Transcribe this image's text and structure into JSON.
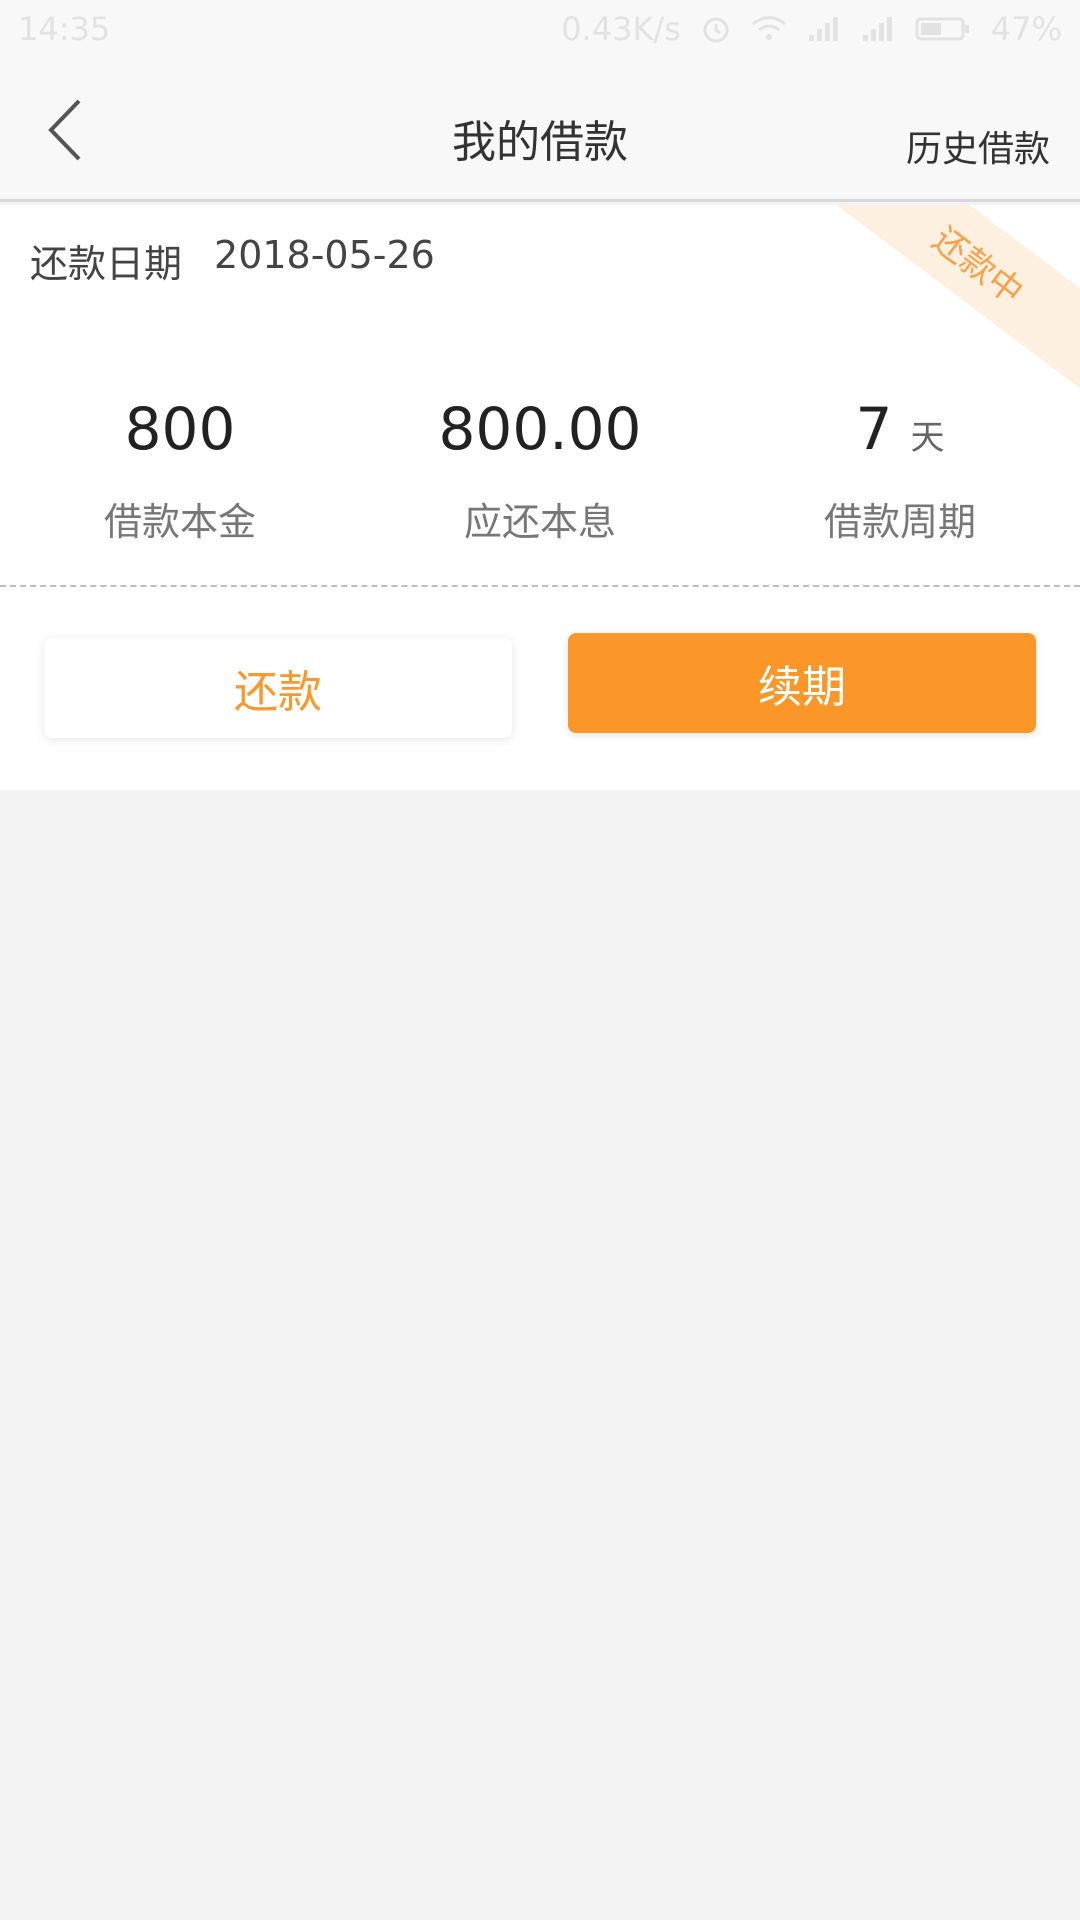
{
  "status_bar": {
    "time": "14:35",
    "network_speed": "0.43K/s",
    "battery": "47%",
    "icons": [
      "alarm-icon",
      "wifi-icon",
      "signal-icon",
      "signal-icon",
      "battery-icon"
    ]
  },
  "header": {
    "back_icon": "chevron-left-icon",
    "title": "我的借款",
    "history_label": "历史借款"
  },
  "loan": {
    "status_ribbon": "还款中",
    "due_label": "还款日期",
    "due_date": "2018-05-26",
    "stats": [
      {
        "value": "800",
        "label": "借款本金"
      },
      {
        "value": "800.00",
        "label": "应还本息"
      },
      {
        "value": "7",
        "unit": "天",
        "label": "借款周期"
      }
    ],
    "repay_label": "还款",
    "renew_label": "续期"
  },
  "colors": {
    "accent": "#fb9729",
    "ribbon_bg": "#fdf0e0",
    "ribbon_text": "#f6a14b",
    "page_bg": "#f3f3f3"
  }
}
